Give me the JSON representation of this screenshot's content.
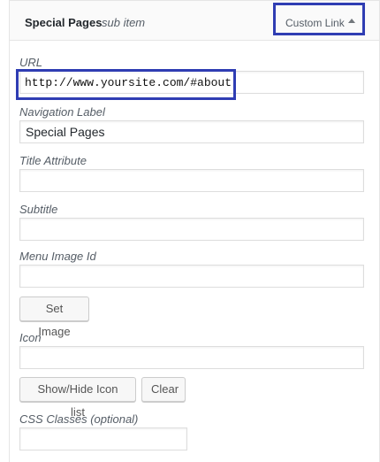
{
  "header": {
    "title": "Special Pages",
    "subtitle": "sub item",
    "item_type": "Custom Link",
    "toggle_icon": "triangle-up-icon"
  },
  "fields": {
    "url": {
      "label": "URL",
      "value": "http://www.yoursite.com/#about"
    },
    "navigation_label": {
      "label": "Navigation Label",
      "value": "Special Pages"
    },
    "title_attribute": {
      "label": "Title Attribute",
      "value": ""
    },
    "subtitle": {
      "label": "Subtitle",
      "value": ""
    },
    "menu_image_id": {
      "label": "Menu Image Id",
      "value": ""
    },
    "icon": {
      "label": "Icon",
      "value": ""
    },
    "css_classes": {
      "label": "CSS Classes (optional)",
      "value": ""
    }
  },
  "buttons": {
    "set_image": "Set Image",
    "toggle_icon_list": "Show/Hide Icon list",
    "clear": "Clear"
  },
  "colors": {
    "highlight": "#2f3db3",
    "border": "#dddddd",
    "header_bg": "#fafafa"
  }
}
